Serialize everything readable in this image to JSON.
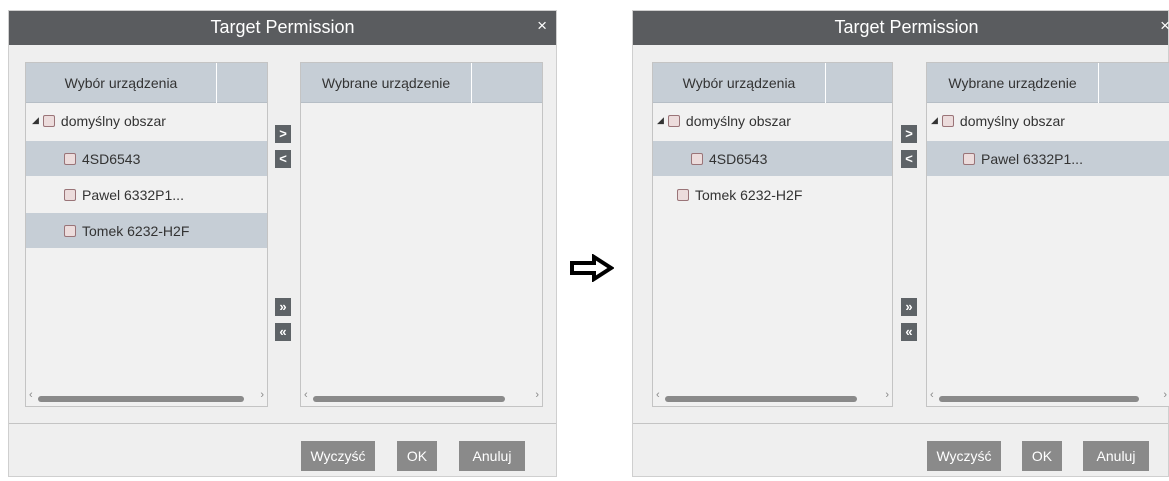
{
  "left_dialog": {
    "title": "Target Permission",
    "close": "×",
    "left_panel": {
      "header": "Wybór urządzenia",
      "group": "domyślny obszar",
      "items": [
        "4SD6543",
        "Pawel  6332P1...",
        "Tomek 6232-H2F"
      ]
    },
    "right_panel": {
      "header": "Wybrane urządzenie"
    },
    "transfer_buttons": {
      "add": ">",
      "remove": "<",
      "add_all": "»",
      "remove_all": "«"
    },
    "buttons": {
      "clear": "Wyczyść",
      "ok": "OK",
      "cancel": "Anuluj"
    }
  },
  "arrow": "⇨",
  "right_dialog": {
    "title": "Target Permission",
    "close": "×",
    "left_panel": {
      "header": "Wybór urządzenia",
      "group": "domyślny obszar",
      "items": [
        "4SD6543",
        "Tomek 6232-H2F"
      ]
    },
    "right_panel": {
      "header": "Wybrane urządzenie",
      "group": "domyślny obszar",
      "items": [
        "Pawel  6332P1..."
      ]
    },
    "transfer_buttons": {
      "add": ">",
      "remove": "<",
      "add_all": "»",
      "remove_all": "«"
    },
    "buttons": {
      "clear": "Wyczyść",
      "ok": "OK",
      "cancel": "Anuluj"
    }
  },
  "colors": {
    "titlebar": "#5a5c5f",
    "header": "#c6ced6",
    "selected_row": "#c6ced6",
    "button": "#8a8a8a",
    "transfer_button": "#5e6367"
  }
}
